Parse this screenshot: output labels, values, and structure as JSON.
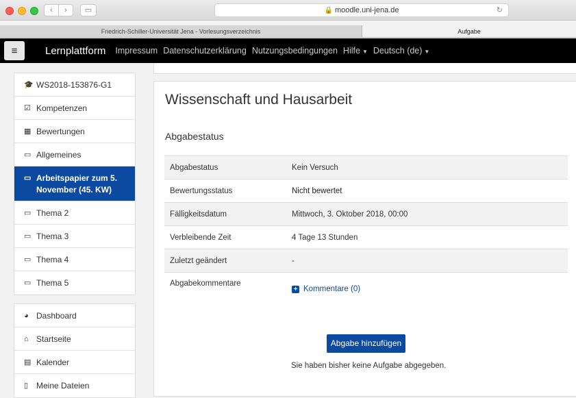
{
  "browser": {
    "address": "moodle.uni-jena.de",
    "tabs": [
      "Friedrich-Schiller-Universität Jena - Vorlesungsverzeichnis",
      "Aufgabe"
    ]
  },
  "topnav": {
    "brand": "Lernplattform",
    "links": [
      "Impressum",
      "Datenschutzerklärung",
      "Nutzungsbedingungen",
      "Hilfe",
      "Deutsch (de)"
    ]
  },
  "sidebar": {
    "course_items": [
      {
        "icon": "graduation-cap-icon",
        "label": "WS2018-153876-G1"
      },
      {
        "icon": "checkbox-icon",
        "label": "Kompetenzen"
      },
      {
        "icon": "table-icon",
        "label": "Bewertungen"
      },
      {
        "icon": "folder-icon",
        "label": "Allgemeines"
      },
      {
        "icon": "folder-icon",
        "label": "Arbeitspapier zum 5. November (45. KW)"
      },
      {
        "icon": "folder-icon",
        "label": "Thema 2"
      },
      {
        "icon": "folder-icon",
        "label": "Thema 3"
      },
      {
        "icon": "folder-icon",
        "label": "Thema 4"
      },
      {
        "icon": "folder-icon",
        "label": "Thema 5"
      }
    ],
    "general_items": [
      {
        "icon": "dashboard-icon",
        "label": "Dashboard"
      },
      {
        "icon": "home-icon",
        "label": "Startseite"
      },
      {
        "icon": "calendar-icon",
        "label": "Kalender"
      },
      {
        "icon": "file-icon",
        "label": "Meine Dateien"
      }
    ]
  },
  "main": {
    "title": "Wissenschaft und Hausarbeit",
    "section": "Abgabestatus",
    "rows": [
      {
        "label": "Abgabestatus",
        "value": "Kein Versuch"
      },
      {
        "label": "Bewertungsstatus",
        "value": "Nicht bewertet"
      },
      {
        "label": "Fälligkeitsdatum",
        "value": "Mittwoch, 3. Oktober 2018, 00:00"
      },
      {
        "label": "Verbleibende Zeit",
        "value": "4 Tage 13 Stunden"
      },
      {
        "label": "Zuletzt geändert",
        "value": "-"
      },
      {
        "label": "Abgabekommentare",
        "value": ""
      }
    ],
    "comments_link": "Kommentare (0)",
    "add_button": "Abgabe hinzufügen",
    "notice": "Sie haben bisher keine Aufgabe abgegeben."
  }
}
